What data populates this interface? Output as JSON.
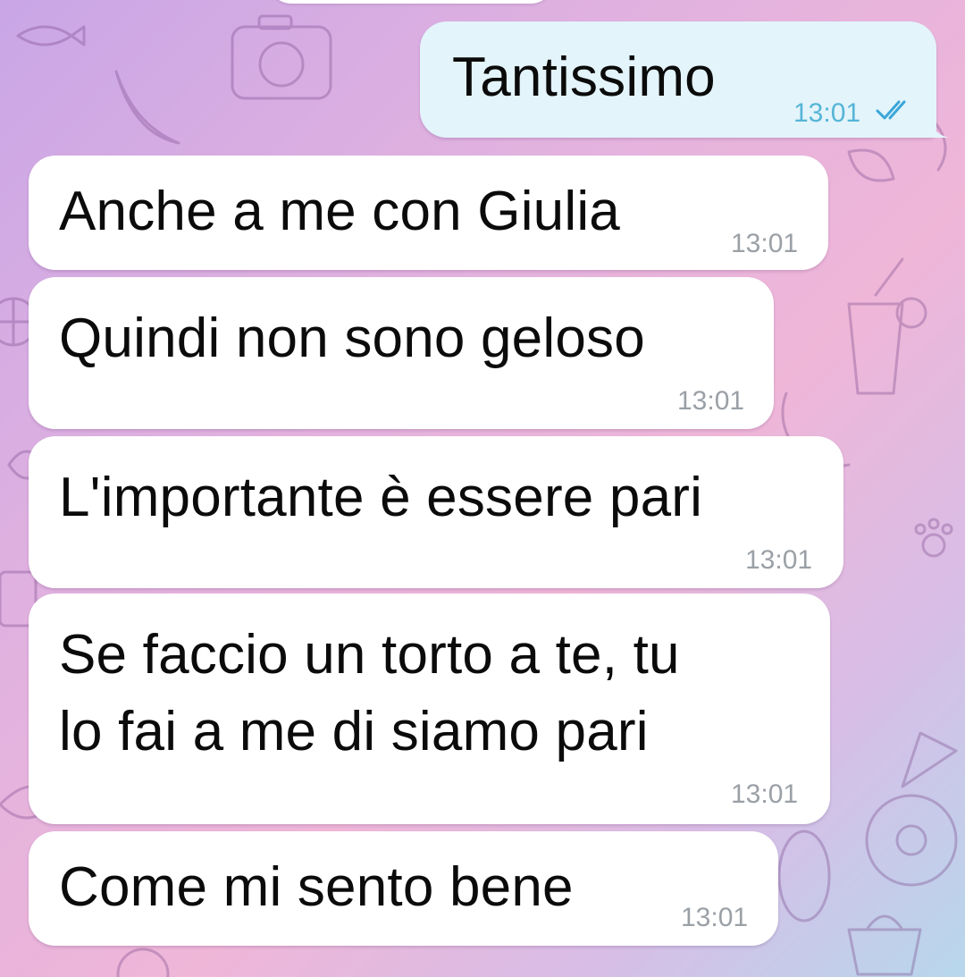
{
  "chat": {
    "messages": [
      {
        "direction": "outgoing",
        "text": "Tantissimo",
        "time": "13:01",
        "status": "read"
      },
      {
        "direction": "incoming",
        "text": "Anche a me con Giulia",
        "time": "13:01"
      },
      {
        "direction": "incoming",
        "text": "Quindi non sono geloso",
        "time": "13:01"
      },
      {
        "direction": "incoming",
        "text": "L'importante è essere pari",
        "time": "13:01"
      },
      {
        "direction": "incoming",
        "text_line1": "Se faccio un torto a te, tu",
        "text_line2": "lo fai a me di siamo pari",
        "time": "13:01"
      },
      {
        "direction": "incoming",
        "text": "Come mi sento bene",
        "time": "13:01"
      }
    ]
  },
  "colors": {
    "incoming_bubble": "#ffffff",
    "outgoing_bubble": "#e3f4fb",
    "time_incoming": "#9aa0a6",
    "time_outgoing": "#56b5d6",
    "read_check": "#3aa6d8"
  },
  "icons": {
    "read_status": "double-check-icon"
  }
}
